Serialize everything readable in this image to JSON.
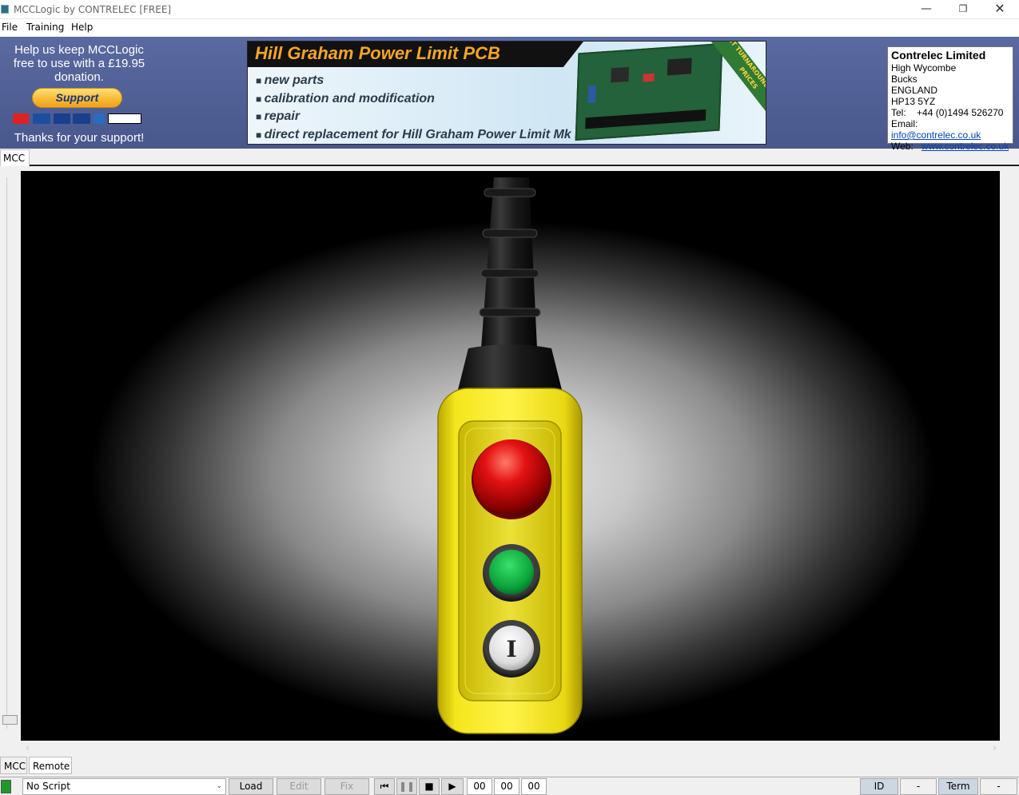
{
  "window": {
    "title": "MCCLogic by CONTRELEC [FREE]"
  },
  "menu": [
    "File",
    "Training",
    "Help"
  ],
  "donation": {
    "message": "Help us keep MCCLogic free to use with a £19.95 donation.",
    "support_label": "Support",
    "thanks": "Thanks for your support!"
  },
  "ad": {
    "headline": "Hill Graham Power Limit PCB",
    "bullets": [
      "new parts",
      "calibration and modification",
      "repair",
      "direct replacement for Hill Graham Power Limit Mk II"
    ],
    "ribbon": "FAST TURNAROUND LOWEST PRICES"
  },
  "contact": {
    "name": "Contrelec Limited",
    "lines": [
      "High Wycombe",
      "Bucks",
      "ENGLAND",
      "HP13 5YZ"
    ],
    "tel_label": "Tel:",
    "tel": "+44 (0)1494 526270",
    "email_label": "Email:",
    "email": "info@contrelec.co.uk",
    "web_label": "Web:",
    "web": "www.contrelec.co.uk"
  },
  "tabs_top": [
    "MCC"
  ],
  "tabs_bottom": [
    "MCC",
    "Remote"
  ],
  "pendant": {
    "start_button_symbol": "I"
  },
  "statusbar": {
    "script_select": "No Script",
    "load": "Load",
    "edit": "Edit",
    "fix": "Fix",
    "time_h": "00",
    "time_m": "00",
    "time_s": "00",
    "id_label": "ID",
    "id_value": "-",
    "term_label": "Term",
    "term_value": "-",
    "status_color": "#1f9a2a"
  }
}
